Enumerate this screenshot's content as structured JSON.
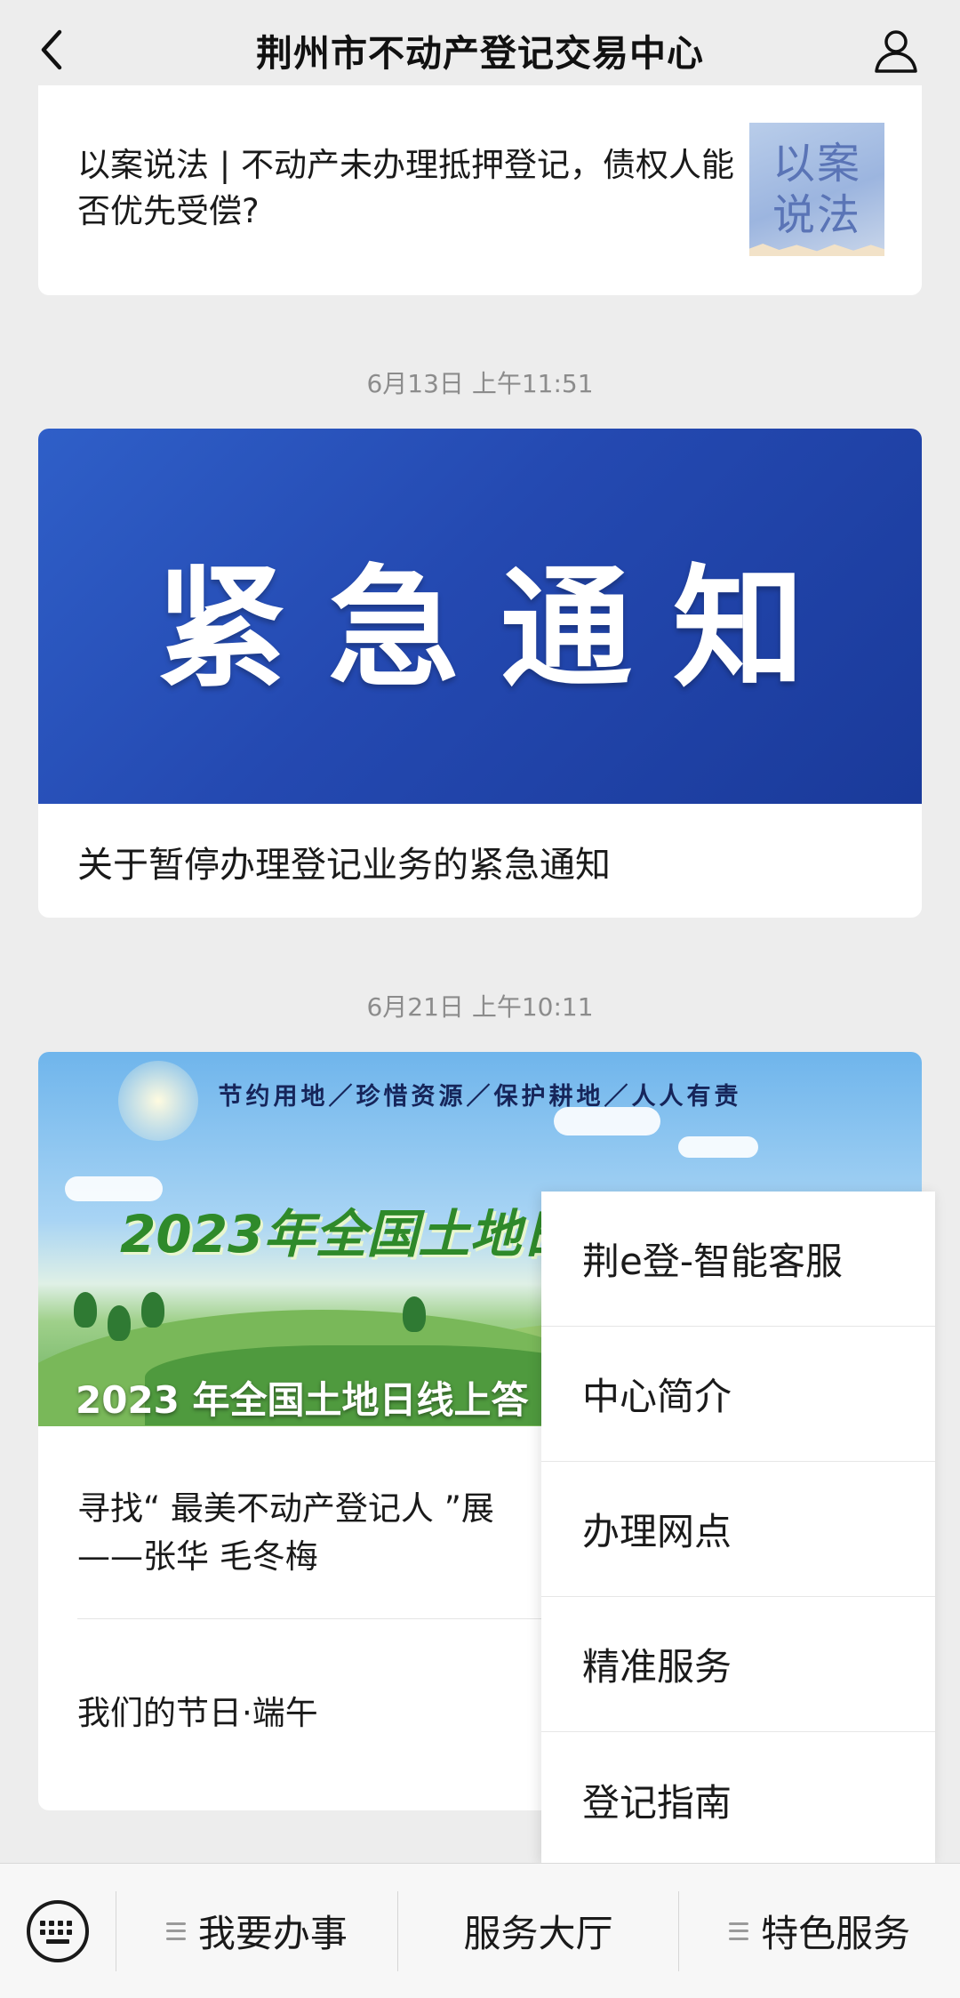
{
  "header": {
    "title": "荆州市不动产登记交易中心",
    "back_icon": "chevron-left-icon",
    "profile_icon": "person-icon"
  },
  "articles": [
    {
      "title": "以案说法 | 不动产未办理抵押登记，债权人能否优先受偿?",
      "thumb_text_line1": "以案",
      "thumb_text_line2": "说法"
    }
  ],
  "messages": [
    {
      "timestamp": "6月13日 上午11:51",
      "banner_text": "紧急通知",
      "caption": "关于暂停办理登记业务的紧急通知"
    },
    {
      "timestamp": "6月21日 上午10:11",
      "banner_slogan": "节约用地／珍惜资源／保护耕地／人人有责",
      "banner_headline": "2023年全国土地日",
      "banner_overlay_title": "2023 年全国土地日线上答",
      "items": [
        "寻找“ 最美不动产登记人 ”展",
        "——张华 毛冬梅",
        "我们的节日·端午"
      ]
    }
  ],
  "popup_menu": {
    "items": [
      "荆e登-智能客服",
      "中心简介",
      "办理网点",
      "精准服务",
      "登记指南"
    ]
  },
  "bottom_menu": {
    "keyboard_icon": "keyboard-icon",
    "items": [
      "我要办事",
      "服务大厅",
      "特色服务"
    ]
  },
  "colors": {
    "background": "#ededed",
    "banner_blue": "#2449b1",
    "headline_green": "#2f8a2a"
  }
}
